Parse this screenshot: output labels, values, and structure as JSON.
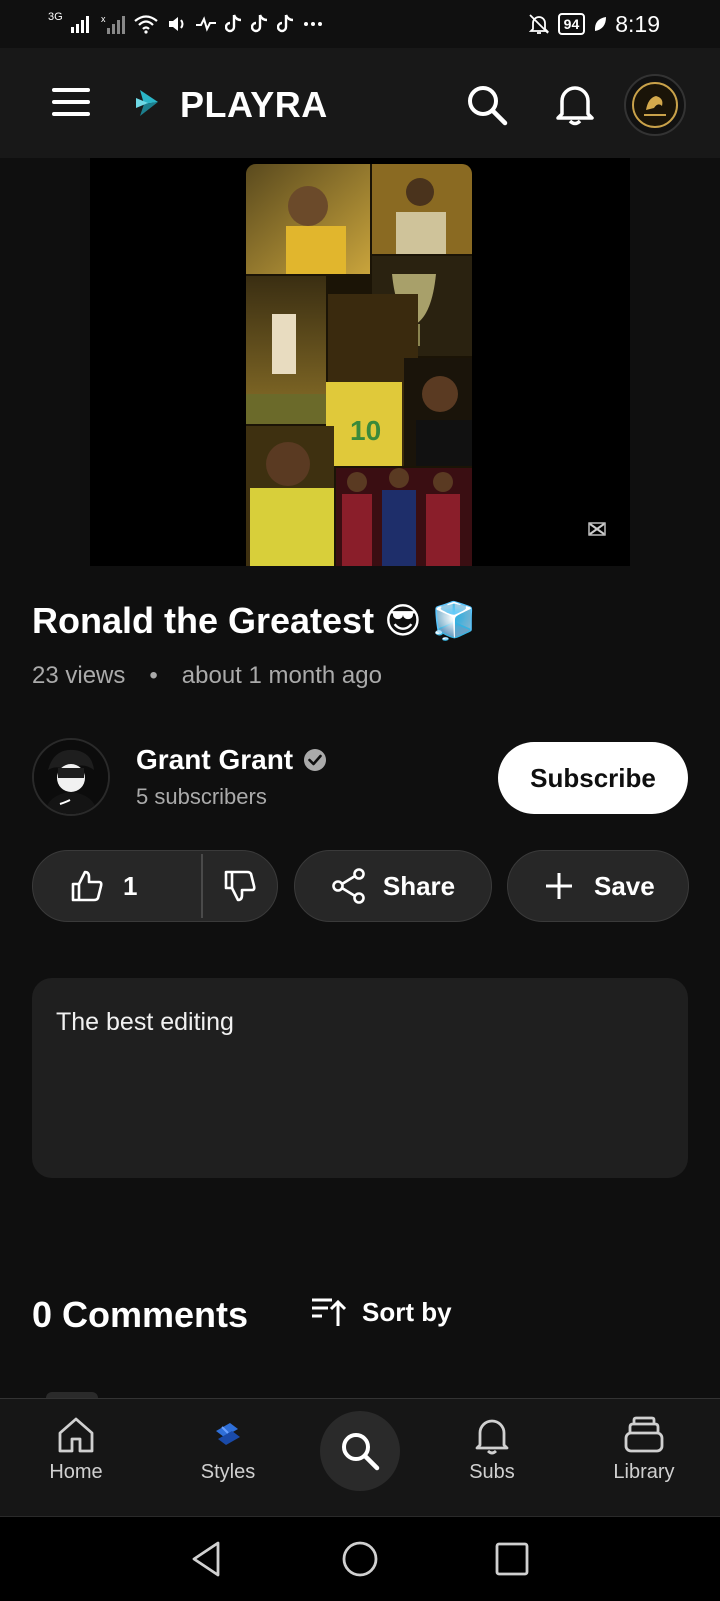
{
  "status_bar": {
    "network_label": "3G",
    "time": "8:19",
    "battery": "94",
    "icons": [
      "signal-icon",
      "signal-x-icon",
      "wifi-icon",
      "volume-icon",
      "activity-icon",
      "tiktok-icon",
      "tiktok-icon",
      "tiktok-icon",
      "more-icon",
      "mute-bell-icon",
      "battery-icon",
      "leaf-icon"
    ]
  },
  "app_bar": {
    "app_name": "PLAYRA",
    "icons": [
      "menu-icon",
      "playra-logo-icon",
      "search-icon",
      "bell-icon",
      "profile-avatar"
    ]
  },
  "video": {
    "title": "Ronald the Greatest 😎 🧊",
    "views": "23 views",
    "separator": "•",
    "uploaded": "about 1 month ago"
  },
  "channel": {
    "name": "Grant Grant",
    "subscribers": "5 subscribers",
    "subscribe_label": "Subscribe"
  },
  "actions": {
    "like_count": "1",
    "share_label": "Share",
    "save_label": "Save"
  },
  "description": {
    "text": "The best editing"
  },
  "comments": {
    "title": "0 Comments",
    "sort_label": "Sort by"
  },
  "bottom_nav": {
    "items": [
      {
        "label": "Home",
        "icon": "home-icon"
      },
      {
        "label": "Styles",
        "icon": "styles-icon"
      },
      {
        "label": "",
        "icon": "search-icon"
      },
      {
        "label": "Subs",
        "icon": "bell-icon"
      },
      {
        "label": "Library",
        "icon": "library-icon"
      }
    ]
  },
  "colors": {
    "background": "#0f0f0f",
    "surface": "#272727",
    "accent": "#2bb5c7",
    "text_secondary": "#aaaaaa"
  }
}
